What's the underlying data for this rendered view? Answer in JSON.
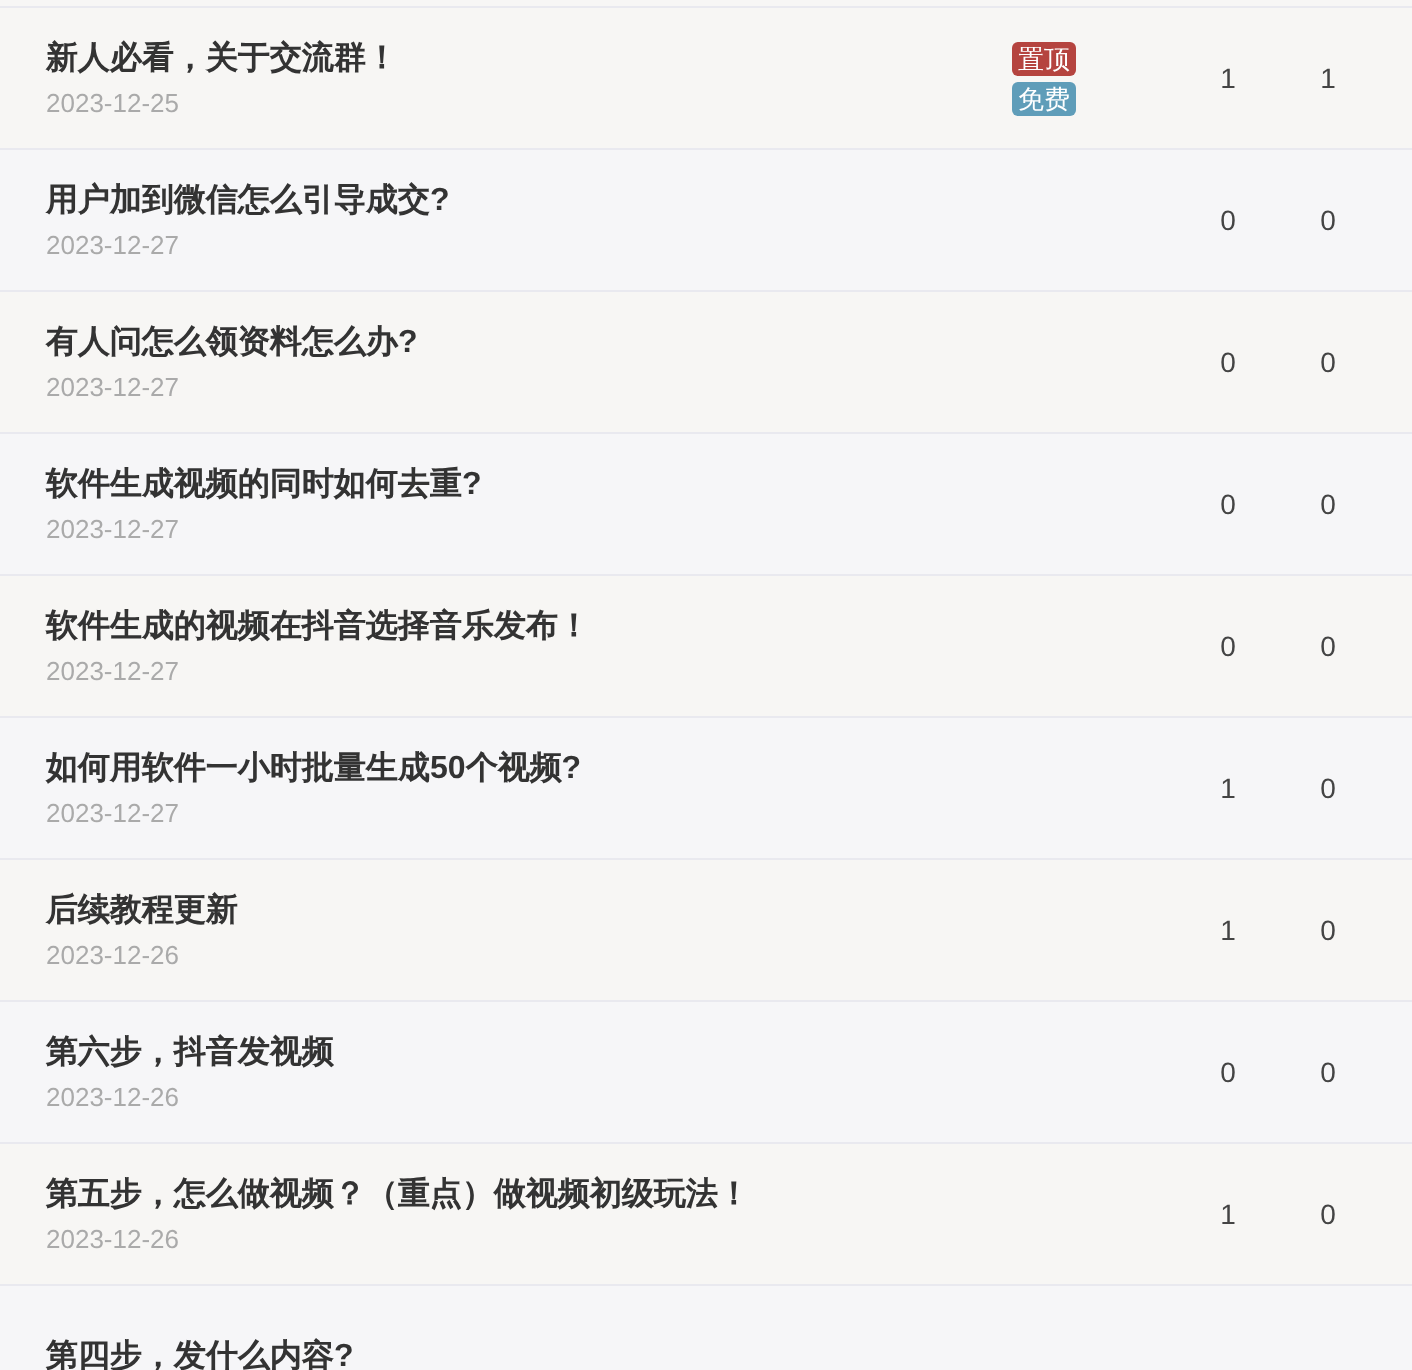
{
  "topics": [
    {
      "title": "新人必看，关于交流群！",
      "date": "2023-12-25",
      "badges": [
        {
          "text": "置顶",
          "kind": "pinned"
        },
        {
          "text": "免费",
          "kind": "free"
        }
      ],
      "count_1": "1",
      "count_2": "1"
    },
    {
      "title": "用户加到微信怎么引导成交?",
      "date": "2023-12-27",
      "count_1": "0",
      "count_2": "0"
    },
    {
      "title": "有人问怎么领资料怎么办?",
      "date": "2023-12-27",
      "count_1": "0",
      "count_2": "0"
    },
    {
      "title": "软件生成视频的同时如何去重?",
      "date": "2023-12-27",
      "count_1": "0",
      "count_2": "0"
    },
    {
      "title": "软件生成的视频在抖音选择音乐发布！",
      "date": "2023-12-27",
      "count_1": "0",
      "count_2": "0"
    },
    {
      "title": "如何用软件一小时批量生成50个视频?",
      "date": "2023-12-27",
      "count_1": "1",
      "count_2": "0"
    },
    {
      "title": "后续教程更新",
      "date": "2023-12-26",
      "count_1": "1",
      "count_2": "0"
    },
    {
      "title": "第六步，抖音发视频",
      "date": "2023-12-26",
      "count_1": "0",
      "count_2": "0"
    },
    {
      "title": "第五步，怎么做视频？（重点）做视频初级玩法！",
      "date": "2023-12-26",
      "count_1": "1",
      "count_2": "0"
    },
    {
      "title": "第四步，发什么内容?"
    }
  ]
}
